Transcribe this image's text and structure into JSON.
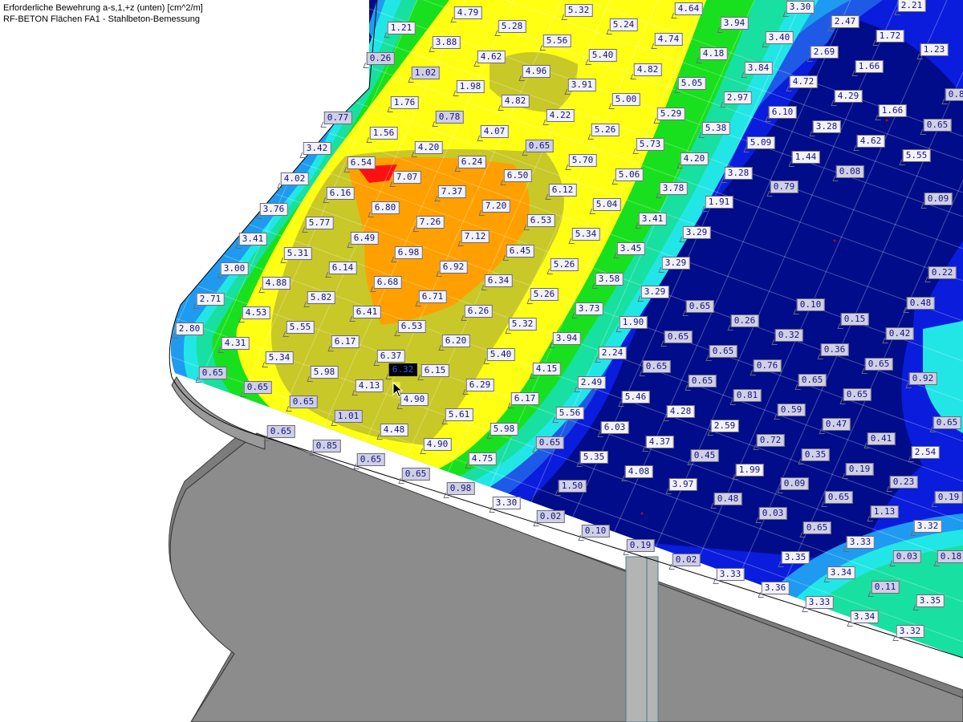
{
  "header": {
    "title": "Erforderliche Bewehrung a-s,1,+z (unten) [cm^2/m]",
    "subtitle": "RF-BETON Flächen FA1 - Stahlbeton-Bemessung"
  },
  "colors": {
    "navy": "#000c8a",
    "blue": "#0a1cdc",
    "royal": "#1e5ae6",
    "azure": "#1e9bf0",
    "cyan": "#22e6e6",
    "teal": "#18e0a0",
    "green": "#19e01e",
    "yellow": "#ffff14",
    "olive": "#c8c828",
    "orange": "#ffa000",
    "red": "#ff1010",
    "grey_surface": "#8c8c8c",
    "grey_lower": "#7c7c7c",
    "column": "#b4b4b4"
  },
  "selected_value": "6.32",
  "labels": [
    "4.79",
    "5.32",
    "4.64",
    "3.30",
    "2.21",
    "1.21",
    "5.28",
    "5.24",
    "3.94",
    "2.47",
    "3.88",
    "5.56",
    "4.74",
    "3.40",
    "1.72",
    "1.23",
    "4.62",
    "5.40",
    "4.18",
    "2.69",
    "0.26",
    "4.96",
    "4.82",
    "3.84",
    "1.66",
    "1.02",
    "1.98",
    "3.91",
    "5.05",
    "4.72",
    "2.97",
    "1.76",
    "4.82",
    "5.00",
    "4.29",
    "1.66",
    "0.82",
    "0.77",
    "0.78",
    "4.22",
    "5.29",
    "6.10",
    "3.28",
    "1.56",
    "4.07",
    "5.26",
    "5.38",
    "4.62",
    "0.65",
    "0.65",
    "5.73",
    "5.09",
    "3.42",
    "4.20",
    "5.55",
    "1.44",
    "0.08",
    "6.54",
    "6.24",
    "5.70",
    "4.20",
    "3.28",
    "7.07",
    "6.50",
    "5.06",
    "4.02",
    "7.37",
    "6.12",
    "3.78",
    "0.79",
    "6.16",
    "1.91",
    "0.09",
    "3.76",
    "6.80",
    "7.20",
    "5.04",
    "5.77",
    "7.26",
    "6.53",
    "3.41",
    "3.41",
    "7.12",
    "5.34",
    "3.29",
    "6.49",
    "3.45",
    "5.31",
    "6.98",
    "6.45",
    "6.14",
    "6.92",
    "5.26",
    "3.29",
    "0.22",
    "4.88",
    "3.58",
    "6.68",
    "6.34",
    "5.82",
    "6.71",
    "5.26",
    "3.29",
    "0.10",
    "0.48",
    "2.71",
    "0.65",
    "6.26",
    "3.73",
    "4.53",
    "6.41",
    "0.15",
    "0.26",
    "5.55",
    "6.53",
    "5.32",
    "1.90",
    "0.32",
    "0.42",
    "2.80",
    "6.17",
    "6.20",
    "3.94",
    "0.65",
    "0.36",
    "4.31",
    "3.00",
    "6.37",
    "5.40",
    "2.24",
    "0.65",
    "5.34",
    "6.32",
    "0.65",
    "0.76",
    "0.65",
    "0.65",
    "6.15",
    "0.92",
    "4.15",
    "5.98",
    "2.49",
    "0.65",
    "0.65",
    "4.13",
    "6.29",
    "5.46",
    "0.81",
    "0.65",
    "0.65",
    "4.90",
    "6.17",
    "4.28",
    "0.59",
    "0.65",
    "5.61",
    "5.56",
    "2.59",
    "0.47",
    "0.65",
    "1.01",
    "6.03",
    "0.72",
    "0.65",
    "4.48",
    "5.98",
    "4.37",
    "0.35",
    "0.41",
    "0.65",
    "2.54",
    "0.85",
    "4.90",
    "5.35",
    "0.45",
    "0.19",
    "0.65",
    "4.75",
    "4.08",
    "1.99",
    "0.19",
    "0.65",
    "1.50",
    "3.97",
    "0.09",
    "0.23",
    "0.98",
    "3.30",
    "0.48",
    "0.65",
    "0.02",
    "0.03",
    "1.13",
    "0.10",
    "0.65",
    "3.32",
    "0.19",
    "3.33",
    "0.03",
    "0.02",
    "3.33",
    "0.18",
    "3.35",
    "3.34",
    "0.11",
    "3.36",
    "3.33",
    "3.35",
    "3.34",
    "3.32"
  ]
}
